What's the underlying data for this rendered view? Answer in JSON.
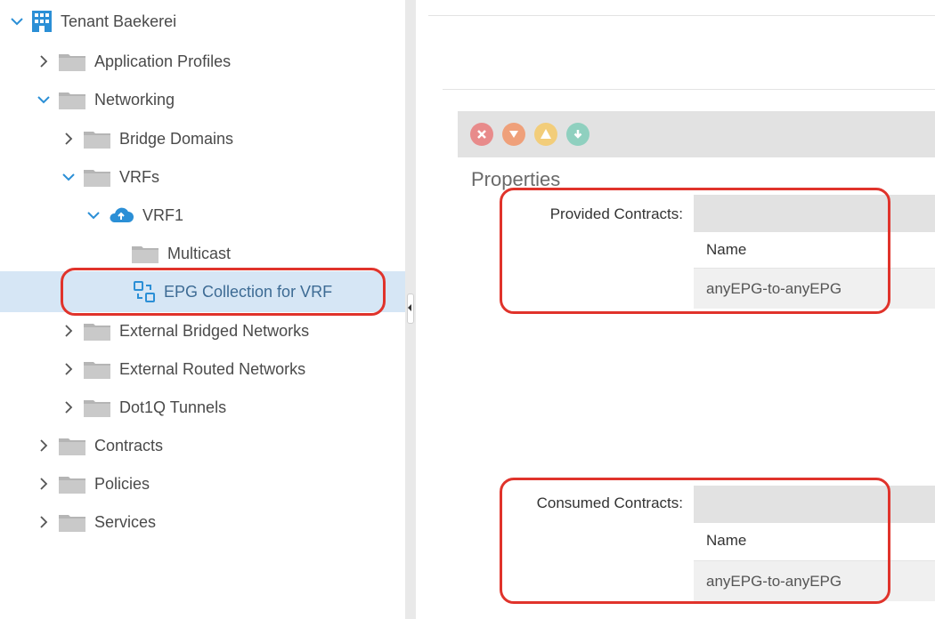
{
  "tree": {
    "items": [
      {
        "label": "Tenant Baekerei",
        "state": "expanded",
        "icon": "tenant-building-icon"
      },
      {
        "label": "Application Profiles",
        "state": "collapsed",
        "icon": "folder-icon"
      },
      {
        "label": "Networking",
        "state": "expanded",
        "icon": "folder-icon"
      },
      {
        "label": "Bridge Domains",
        "state": "collapsed",
        "icon": "folder-icon"
      },
      {
        "label": "VRFs",
        "state": "expanded",
        "icon": "folder-icon"
      },
      {
        "label": "VRF1",
        "state": "expanded",
        "icon": "vrf-cloud-icon"
      },
      {
        "label": "Multicast",
        "state": "leaf",
        "icon": "folder-icon"
      },
      {
        "label": "EPG Collection for VRF",
        "state": "selected",
        "icon": "epg-collection-icon"
      },
      {
        "label": "External Bridged Networks",
        "state": "collapsed",
        "icon": "folder-icon"
      },
      {
        "label": "External Routed Networks",
        "state": "collapsed",
        "icon": "folder-icon"
      },
      {
        "label": "Dot1Q Tunnels",
        "state": "collapsed",
        "icon": "folder-icon"
      },
      {
        "label": "Contracts",
        "state": "collapsed",
        "icon": "folder-icon"
      },
      {
        "label": "Policies",
        "state": "collapsed",
        "icon": "folder-icon"
      },
      {
        "label": "Services",
        "state": "collapsed",
        "icon": "folder-icon"
      }
    ]
  },
  "faults": [
    {
      "name": "critical",
      "icon": "critical-fault-icon",
      "color": "#e88b8b"
    },
    {
      "name": "major",
      "icon": "major-fault-icon",
      "color": "#efa07a"
    },
    {
      "name": "minor",
      "icon": "minor-fault-icon",
      "color": "#f2cd7a"
    },
    {
      "name": "warning",
      "icon": "warning-fault-icon",
      "color": "#8fd0bf"
    }
  ],
  "properties": {
    "title": "Properties",
    "provided": {
      "label": "Provided Contracts:",
      "column": "Name",
      "rows": [
        "anyEPG-to-anyEPG"
      ]
    },
    "consumed": {
      "label": "Consumed Contracts:",
      "column": "Name",
      "rows": [
        "anyEPG-to-anyEPG"
      ]
    }
  },
  "colors": {
    "highlight": "#e0332b",
    "selected_row": "#d6e6f5",
    "accent": "#2b8fd6"
  }
}
